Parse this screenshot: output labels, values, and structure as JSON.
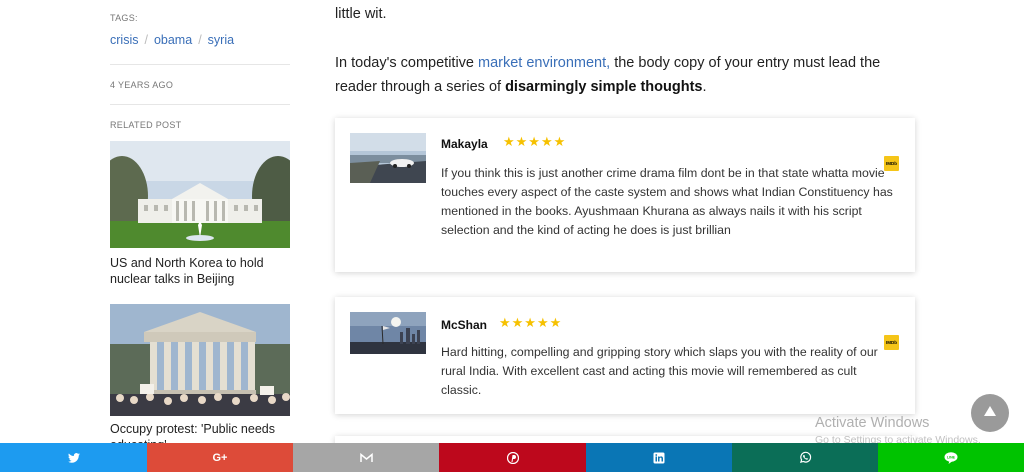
{
  "sidebar": {
    "tags_label": "TAGS:",
    "tags": [
      "crisis",
      "obama",
      "syria"
    ],
    "tag_separator": "/",
    "time_ago": "4 YEARS AGO",
    "related_label": "RELATED POST",
    "related_posts": [
      {
        "title": "US and North Korea to hold nuclear talks in Beijing"
      },
      {
        "title": "Occupy protest: 'Public needs educating'"
      }
    ]
  },
  "main": {
    "top_line": "little wit.",
    "para_before_link": "In today's competitive ",
    "para_link": "market environment,",
    "para_middle": " the body copy of your entry must lead the reader through a series of ",
    "para_bold": "disarmingly simple thoughts",
    "para_end": "."
  },
  "reviews": [
    {
      "name": "Makayla",
      "stars": "★★★★★",
      "rating": 5,
      "badge": "IMDb",
      "text": "If you think this is just another crime drama film dont be in that state whatta movie touches every aspect of the caste system and shows what Indian Constituency has mentioned in the books. Ayushmaan Khurana as always nails it with his script selection and the kind of acting he does is just brillian"
    },
    {
      "name": "McShan",
      "stars": "★★★★★",
      "rating": 5,
      "badge": "IMDb",
      "text": "Hard hitting, compelling and gripping story which slaps you with the reality of our rural India. With excellent cast and acting this movie will remembered as cult classic."
    }
  ],
  "watermark": {
    "title": "Activate Windows",
    "subtitle": "Go to Settings to activate Windows."
  },
  "share_bar": [
    {
      "name": "twitter",
      "icon": "twitter-icon",
      "color": "#1d9bf0"
    },
    {
      "name": "googleplus",
      "icon": "google-plus-icon",
      "color": "#dd4b39",
      "label": "G+"
    },
    {
      "name": "email",
      "icon": "mail-icon",
      "color": "#a6a6a6"
    },
    {
      "name": "pinterest",
      "icon": "pinterest-icon",
      "color": "#bd081c"
    },
    {
      "name": "linkedin",
      "icon": "linkedin-icon",
      "color": "#0a76b5"
    },
    {
      "name": "whatsapp",
      "icon": "whatsapp-icon",
      "color": "#0b6e57"
    },
    {
      "name": "line",
      "icon": "line-icon",
      "color": "#00c300"
    }
  ]
}
